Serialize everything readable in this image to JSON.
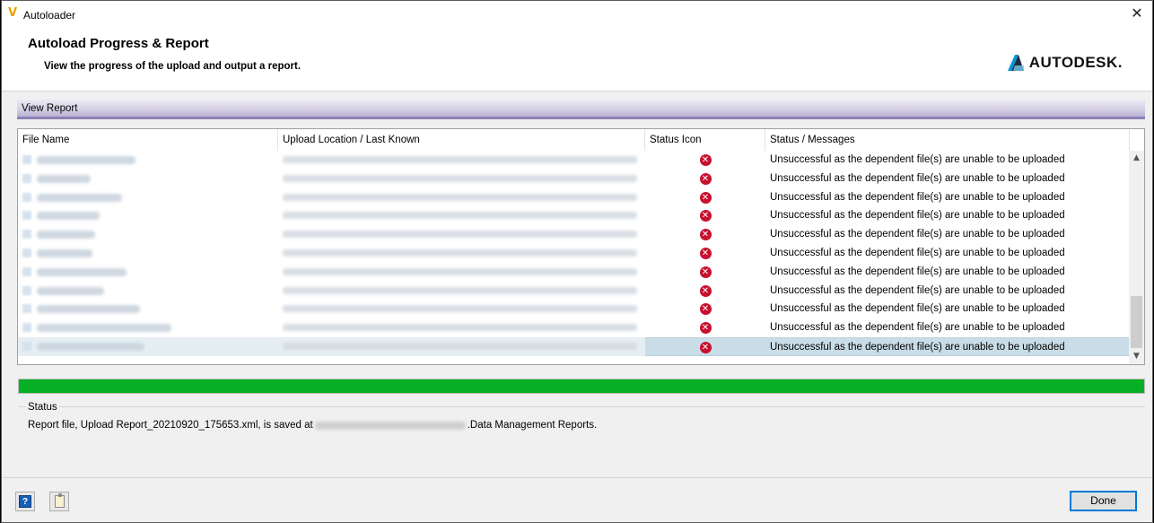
{
  "window": {
    "title": "Autoloader",
    "close_glyph": "✕",
    "app_icon": "V"
  },
  "header": {
    "title": "Autoload Progress & Report",
    "subtitle": "View the progress of the upload and output a report.",
    "brand": "AUTODESK."
  },
  "report_bar": {
    "label": "View Report"
  },
  "table": {
    "columns": [
      "File Name",
      "Upload Location / Last Known",
      "Status Icon",
      "Status / Messages"
    ],
    "rows": [
      {
        "status_message": "Unsuccessful as the dependent file(s) are unable to be uploaded",
        "status_icon": "error-icon",
        "selected": false
      },
      {
        "status_message": "Unsuccessful as the dependent file(s) are unable to be uploaded",
        "status_icon": "error-icon",
        "selected": false
      },
      {
        "status_message": "Unsuccessful as the dependent file(s) are unable to be uploaded",
        "status_icon": "error-icon",
        "selected": false
      },
      {
        "status_message": "Unsuccessful as the dependent file(s) are unable to be uploaded",
        "status_icon": "error-icon",
        "selected": false
      },
      {
        "status_message": "Unsuccessful as the dependent file(s) are unable to be uploaded",
        "status_icon": "error-icon",
        "selected": false
      },
      {
        "status_message": "Unsuccessful as the dependent file(s) are unable to be uploaded",
        "status_icon": "error-icon",
        "selected": false
      },
      {
        "status_message": "Unsuccessful as the dependent file(s) are unable to be uploaded",
        "status_icon": "error-icon",
        "selected": false
      },
      {
        "status_message": "Unsuccessful as the dependent file(s) are unable to be uploaded",
        "status_icon": "error-icon",
        "selected": false
      },
      {
        "status_message": "Unsuccessful as the dependent file(s) are unable to be uploaded",
        "status_icon": "error-icon",
        "selected": false
      },
      {
        "status_message": "Unsuccessful as the dependent file(s) are unable to be uploaded",
        "status_icon": "error-icon",
        "selected": false
      },
      {
        "status_message": "Unsuccessful as the dependent file(s) are unable to be uploaded",
        "status_icon": "error-icon",
        "selected": true
      }
    ]
  },
  "progress": {
    "value_percent": 100,
    "color": "#06b025"
  },
  "status": {
    "legend": "Status",
    "text_before": "Report file, Upload Report_20210920_175653.xml, is saved at",
    "text_after": ".Data Management Reports."
  },
  "footer": {
    "done_label": "Done",
    "help_glyph": "?"
  },
  "colors": {
    "accent": "#0078d7",
    "error": "#c8102e",
    "selection": "#c9dde8"
  }
}
